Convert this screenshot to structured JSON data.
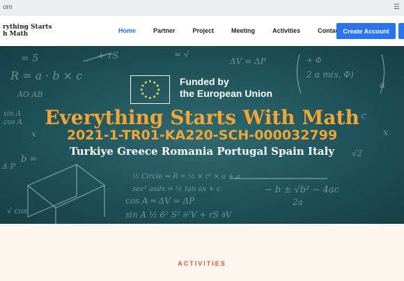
{
  "browser": {
    "url_fragment": "om",
    "toolbar_glyph": "☰"
  },
  "site": {
    "logo_line1": "rything Starts",
    "logo_line2": "h Math"
  },
  "nav": {
    "items": [
      {
        "label": "Home",
        "active": true
      },
      {
        "label": "Partner",
        "active": false
      },
      {
        "label": "Project",
        "active": false
      },
      {
        "label": "Meeting",
        "active": false
      },
      {
        "label": "Activities",
        "active": false
      },
      {
        "label": "Contact",
        "active": false
      }
    ],
    "create_account_label": "Create Account"
  },
  "hero": {
    "funded_line1": "Funded by",
    "funded_line2": "the European Union",
    "title": "Everything Starts With Math",
    "project_code": "2021-1-TR01-KA220-SCH-000032799",
    "countries": "Turkiye Greece Romania Portugal Spain Italy"
  },
  "section": {
    "title": "ACTIVITIES"
  },
  "colors": {
    "accent": "#2a75ee",
    "hero_title": "#f3a535",
    "section_title": "#e5522a",
    "section_bg": "#fdf6ef"
  }
}
